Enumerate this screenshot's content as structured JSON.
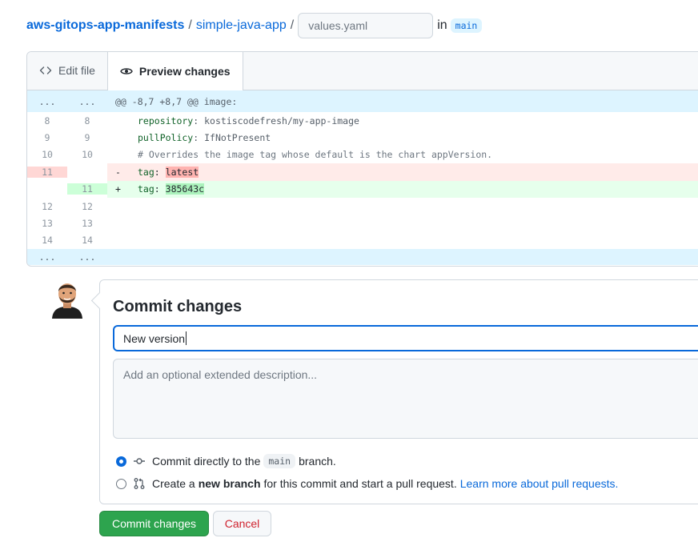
{
  "breadcrumb": {
    "repo": "aws-gitops-app-manifests",
    "folder": "simple-java-app",
    "separator": "/",
    "filename_placeholder": "values.yaml",
    "in_label": "in",
    "branch": "main"
  },
  "tabs": {
    "edit_file": "Edit file",
    "preview_changes": "Preview changes"
  },
  "diff": {
    "hunk_dots_left": "...",
    "hunk_dots_right": "...",
    "hunk_header": "@@ -8,7 +8,7 @@ image:",
    "lines": [
      {
        "type": "context",
        "old": "8",
        "new": "8",
        "key": "repository",
        "rest": ": kostiscodefresh/my-app-image"
      },
      {
        "type": "context",
        "old": "9",
        "new": "9",
        "key": "pullPolicy",
        "rest": ": IfNotPresent"
      },
      {
        "type": "comment",
        "old": "10",
        "new": "10",
        "text": "# Overrides the image tag whose default is the chart appVersion."
      },
      {
        "type": "del",
        "old": "11",
        "new": "",
        "marker": "-",
        "key": "tag",
        "rest": ": ",
        "highlight": "latest"
      },
      {
        "type": "add",
        "old": "",
        "new": "11",
        "marker": "+",
        "key": "tag",
        "rest": ": ",
        "highlight": "385643c"
      },
      {
        "type": "empty",
        "old": "12",
        "new": "12"
      },
      {
        "type": "empty",
        "old": "13",
        "new": "13"
      },
      {
        "type": "empty",
        "old": "14",
        "new": "14"
      }
    ],
    "expand_dots_left": "...",
    "expand_dots_right": "..."
  },
  "commit": {
    "title": "Commit changes",
    "summary_value": "New version",
    "description_placeholder": "Add an optional extended description...",
    "option_direct": {
      "before": "Commit directly to the",
      "branch": "main",
      "after": "branch.",
      "checked": true
    },
    "option_new_branch": {
      "before": "Create a",
      "bold": "new branch",
      "after": "for this commit and start a pull request.",
      "link": "Learn more about pull requests.",
      "checked": false
    },
    "submit_label": "Commit changes",
    "cancel_label": "Cancel"
  },
  "colors": {
    "link": "#0969da",
    "primary_button": "#2da44e",
    "cancel_text": "#cf222e",
    "deleted_bg": "#ffebe9",
    "added_bg": "#e6ffec"
  }
}
